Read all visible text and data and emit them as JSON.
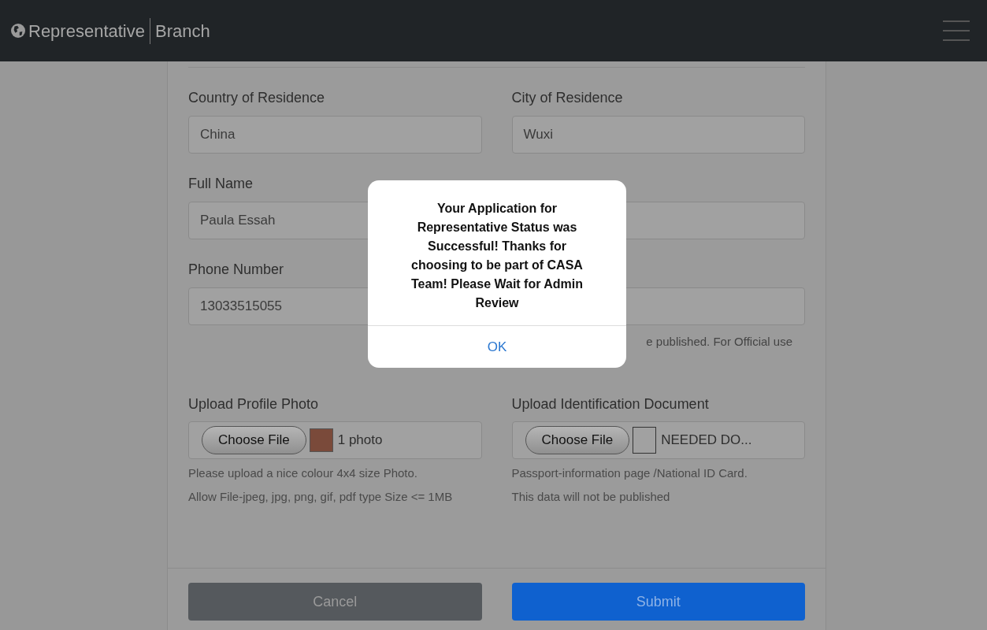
{
  "navbar": {
    "brand": "Representative",
    "subtitle": "Branch"
  },
  "rows": [
    {
      "left": {
        "label": "Country of Residence",
        "value": "China"
      },
      "right": {
        "label": "City of Residence",
        "value": "Wuxi"
      }
    },
    {
      "left": {
        "label": "Full Name",
        "value": "Paula Essah"
      },
      "right": {}
    },
    {
      "left": {
        "label": "Phone Number",
        "value": "13033515055"
      },
      "right": {
        "hint": "e published. For Official use"
      }
    }
  ],
  "uploads": [
    {
      "label": "Upload Profile Photo",
      "button": "Choose File",
      "kind": "photo",
      "file": "1 photo",
      "hints": [
        "Please upload a nice colour 4x4 size Photo.",
        "Allow File-jpeg, jpg, png, gif, pdf type Size <= 1MB"
      ]
    },
    {
      "label": "Upload Identification Document",
      "button": "Choose File",
      "kind": "blank",
      "file": "NEEDED DO...",
      "hints": [
        "Passport-information page /National ID Card.",
        "This data will not be published"
      ]
    }
  ],
  "actions": [
    {
      "label": "Cancel",
      "kind": "secondary"
    },
    {
      "label": "Submit",
      "kind": "primary"
    }
  ],
  "dialog": {
    "message": "Your Application for Representative Status was Successful! Thanks for choosing to be part of CASA Team! Please Wait for Admin Review",
    "button": "OK"
  }
}
